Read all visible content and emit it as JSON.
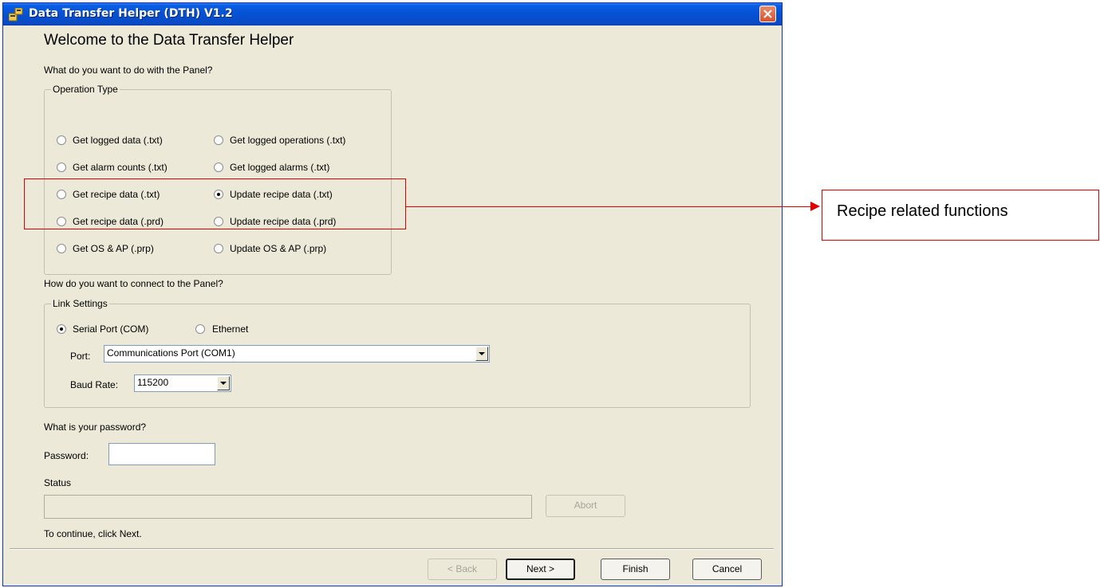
{
  "window": {
    "title": "Data Transfer Helper (DTH) V1.2"
  },
  "main": {
    "heading": "Welcome to the Data Transfer Helper",
    "question_operation": "What do you want to do with the Panel?",
    "question_connect": "How do you want to connect to the Panel?",
    "question_password": "What is your password?",
    "continue_hint": "To continue, click Next."
  },
  "operation_type": {
    "legend": "Operation Type",
    "options": [
      {
        "label": "Get logged data (.txt)",
        "checked": false
      },
      {
        "label": "Get logged operations (.txt)",
        "checked": false
      },
      {
        "label": "Get alarm counts (.txt)",
        "checked": false
      },
      {
        "label": "Get logged alarms (.txt)",
        "checked": false
      },
      {
        "label": "Get recipe data (.txt)",
        "checked": false
      },
      {
        "label": "Update recipe data (.txt)",
        "checked": true
      },
      {
        "label": "Get recipe data (.prd)",
        "checked": false
      },
      {
        "label": "Update recipe data (.prd)",
        "checked": false
      },
      {
        "label": "Get OS & AP (.prp)",
        "checked": false
      },
      {
        "label": "Update OS & AP (.prp)",
        "checked": false
      }
    ]
  },
  "link_settings": {
    "legend": "Link Settings",
    "serial_label": "Serial Port (COM)",
    "ethernet_label": "Ethernet",
    "port_label": "Port:",
    "port_value": "Communications Port (COM1)",
    "baud_label": "Baud Rate:",
    "baud_value": "115200"
  },
  "password": {
    "label": "Password:",
    "value": ""
  },
  "status": {
    "label": "Status",
    "abort_label": "Abort"
  },
  "footer": {
    "back_label": "< Back",
    "next_label": "Next >",
    "finish_label": "Finish",
    "cancel_label": "Cancel"
  },
  "annotation": {
    "callout_text": "Recipe related functions",
    "color": "#e00000"
  }
}
